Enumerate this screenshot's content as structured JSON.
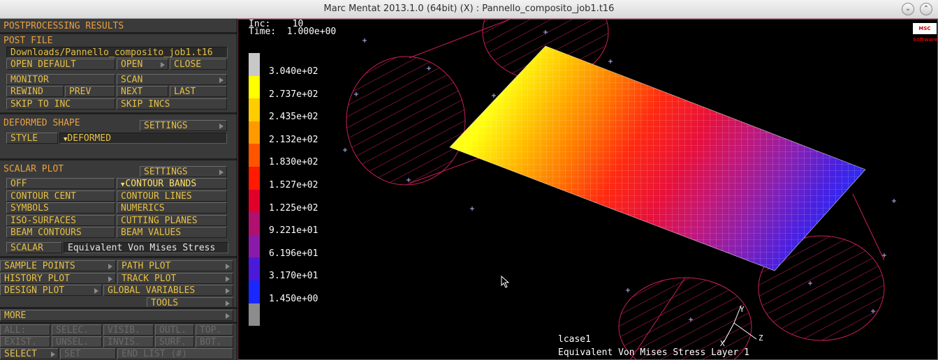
{
  "window": {
    "title": "Marc Mentat 2013.1.0 (64bit) (X) : Pannello_composito_job1.t16"
  },
  "panel": {
    "section_title": "POSTPROCESSING RESULTS",
    "post_file": {
      "header": "POST FILE",
      "path": "Downloads/Pannello_composito_job1.t16",
      "open_default": "OPEN DEFAULT",
      "open": "OPEN",
      "close": "CLOSE",
      "monitor": "MONITOR",
      "scan": "SCAN",
      "rewind": "REWIND",
      "prev": "PREV",
      "next": "NEXT",
      "last": "LAST",
      "skip_to_inc": "SKIP TO INC",
      "skip_incs": "SKIP INCS"
    },
    "deformed": {
      "header": "DEFORMED SHAPE",
      "settings": "SETTINGS",
      "style_label": "STYLE",
      "style_value": "DEFORMED"
    },
    "scalar": {
      "header": "SCALAR PLOT",
      "settings": "SETTINGS",
      "off": "OFF",
      "contour_bands": "CONTOUR BANDS",
      "contour_cent": "CONTOUR CENT",
      "contour_lines": "CONTOUR LINES",
      "symbols": "SYMBOLS",
      "numerics": "NUMERICS",
      "iso_surfaces": "ISO-SURFACES",
      "cutting_planes": "CUTTING PLANES",
      "beam_contours": "BEAM CONTOURS",
      "beam_values": "BEAM VALUES",
      "scalar_label": "SCALAR",
      "scalar_value": "Equivalent Von Mises Stress"
    },
    "plots": {
      "sample_points": "SAMPLE POINTS",
      "path_plot": "PATH PLOT",
      "history_plot": "HISTORY PLOT",
      "track_plot": "TRACK PLOT",
      "design_plot": "DESIGN PLOT",
      "global_variables": "GLOBAL VARIABLES",
      "tools": "TOOLS",
      "more": "MORE"
    },
    "select": {
      "all": "ALL:",
      "selec": "SELEC.",
      "visib": "VISIB.",
      "outl": "OUTL.",
      "top": "TOP.",
      "exist": "EXIST.",
      "unsel": "UNSEL.",
      "invis": "INVIS.",
      "surf": "SURF.",
      "bot": "BOT.",
      "select": "SELECT",
      "set": "SET",
      "end_list": "END LIST (#)"
    }
  },
  "viewport": {
    "inc_label": "Inc:",
    "inc_value": "10",
    "time_label": "Time:",
    "time_value": "1.000e+00",
    "loadcase": "lcase1",
    "result_label": "Equivalent Von Mises Stress Layer 1",
    "logo_text": "MSC Software",
    "axes": {
      "x": "X",
      "y": "Y",
      "z": "Z"
    },
    "legend": [
      {
        "value": "3.040e+02",
        "color": "#c8c8c8"
      },
      {
        "value": "2.737e+02",
        "color": "#ffff00"
      },
      {
        "value": "2.435e+02",
        "color": "#ffcc00"
      },
      {
        "value": "2.132e+02",
        "color": "#ff9900"
      },
      {
        "value": "1.830e+02",
        "color": "#ff5500"
      },
      {
        "value": "1.527e+02",
        "color": "#ff1a00"
      },
      {
        "value": "1.225e+02",
        "color": "#e0002a"
      },
      {
        "value": "9.221e+01",
        "color": "#b0106e"
      },
      {
        "value": "6.196e+01",
        "color": "#8a1aa8"
      },
      {
        "value": "3.170e+01",
        "color": "#4a1ad8"
      },
      {
        "value": "1.450e+00",
        "color": "#1a28ff"
      },
      {
        "value": "",
        "color": "#8c8c8c"
      }
    ]
  }
}
